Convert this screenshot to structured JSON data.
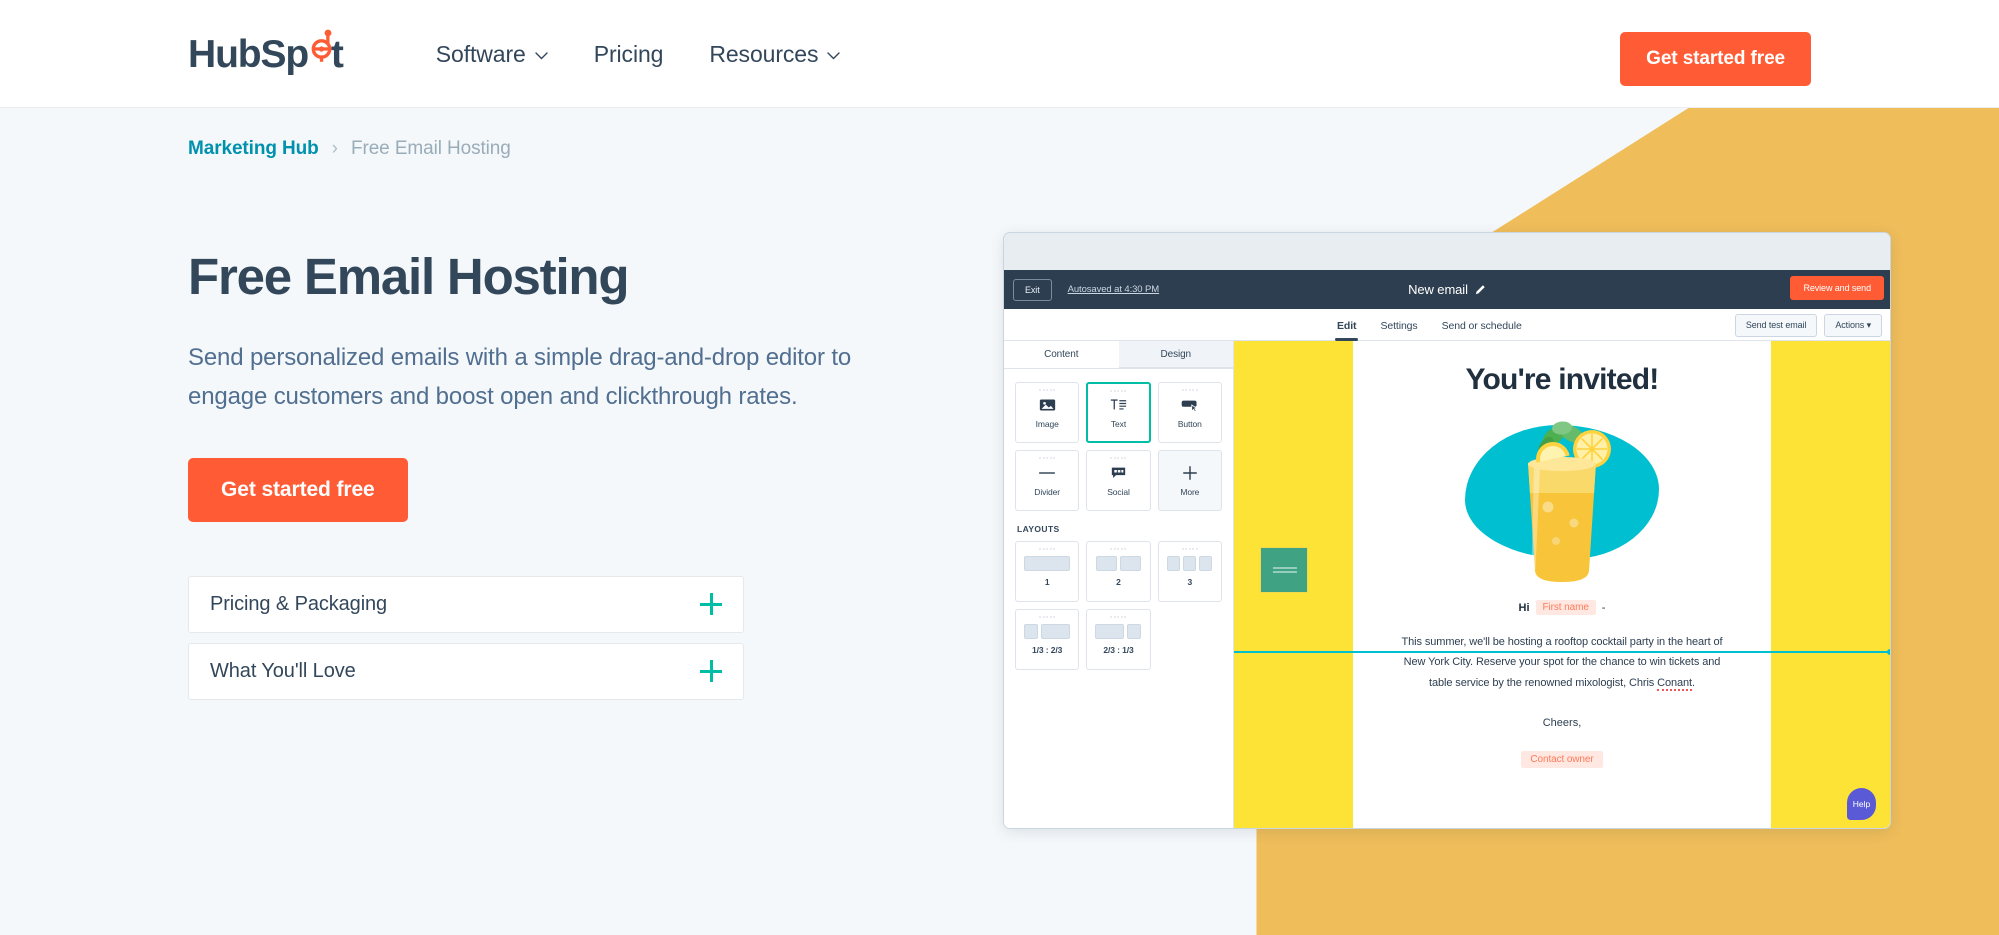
{
  "nav": {
    "logo_text": "HubSp t",
    "logo_name": "HubSpot",
    "links": [
      {
        "label": "Software",
        "has_chevron": true
      },
      {
        "label": "Pricing",
        "has_chevron": false
      },
      {
        "label": "Resources",
        "has_chevron": true
      }
    ],
    "cta_label": "Get started free"
  },
  "breadcrumb": {
    "parent": "Marketing Hub",
    "separator": "›",
    "current": "Free Email Hosting"
  },
  "hero": {
    "title": "Free Email Hosting",
    "subtitle": "Send personalized emails with a simple drag-and-drop editor to engage customers and boost open and clickthrough rates.",
    "cta_label": "Get started free",
    "accordion": [
      {
        "label": "Pricing & Packaging",
        "expanded": false,
        "toggle": "+"
      },
      {
        "label": "What You'll Love",
        "expanded": false,
        "toggle": "+"
      }
    ]
  },
  "mockup": {
    "topbar": {
      "exit_label": "Exit",
      "autosaved_label": "Autosaved at 4:30 PM",
      "title": "New email",
      "review_label": "Review and send"
    },
    "subbar": {
      "tabs": [
        {
          "label": "Edit",
          "active": true
        },
        {
          "label": "Settings",
          "active": false
        },
        {
          "label": "Send or schedule",
          "active": false
        }
      ],
      "buttons": [
        {
          "label": "Send test email"
        },
        {
          "label": "Actions ▾"
        }
      ]
    },
    "sidebar": {
      "tabs": [
        {
          "label": "Content",
          "active": true
        },
        {
          "label": "Design",
          "active": false
        }
      ],
      "modules": [
        {
          "label": "Image",
          "icon": "image-icon",
          "selected": false
        },
        {
          "label": "Text",
          "icon": "text-icon",
          "selected": true
        },
        {
          "label": "Button",
          "icon": "button-icon",
          "selected": false
        },
        {
          "label": "Divider",
          "icon": "divider-icon",
          "selected": false
        },
        {
          "label": "Social",
          "icon": "social-icon",
          "selected": false
        },
        {
          "label": "More",
          "icon": "plus-icon",
          "selected": false
        }
      ],
      "layouts_heading": "LAYOUTS",
      "layouts": [
        {
          "label": "1",
          "cols": [
            1
          ]
        },
        {
          "label": "2",
          "cols": [
            1,
            1
          ]
        },
        {
          "label": "3",
          "cols": [
            1,
            1,
            1
          ]
        },
        {
          "label": "1/3 : 2/3",
          "cols": [
            1,
            2
          ]
        },
        {
          "label": "2/3 : 1/3",
          "cols": [
            2,
            1
          ]
        }
      ]
    },
    "email": {
      "heading": "You're invited!",
      "greeting_prefix": "Hi",
      "greeting_token": "First name",
      "greeting_suffix": "-",
      "body_line1": "This summer, we'll be hosting a rooftop cocktail party in the heart of",
      "body_line2": "New York City. Reserve your spot for the chance to win tickets and",
      "body_line3_pre": "table service by the renowned mixologist, Chris ",
      "body_line3_name": "Conant",
      "body_line3_post": ".",
      "signoff": "Cheers,",
      "owner_token": "Contact owner",
      "help_label": "Help"
    }
  },
  "colors": {
    "brand_orange": "#FF5C35",
    "dark_navy": "#33475B",
    "teal": "#00BDA5",
    "breadcrumb_link": "#0091AE",
    "hero_bg": "#F5F8FA",
    "decor_orange": "#EFBD5A",
    "email_yellow": "#FDE335",
    "email_cyan": "#00BFD0",
    "help_purple": "#5A5AD6"
  }
}
